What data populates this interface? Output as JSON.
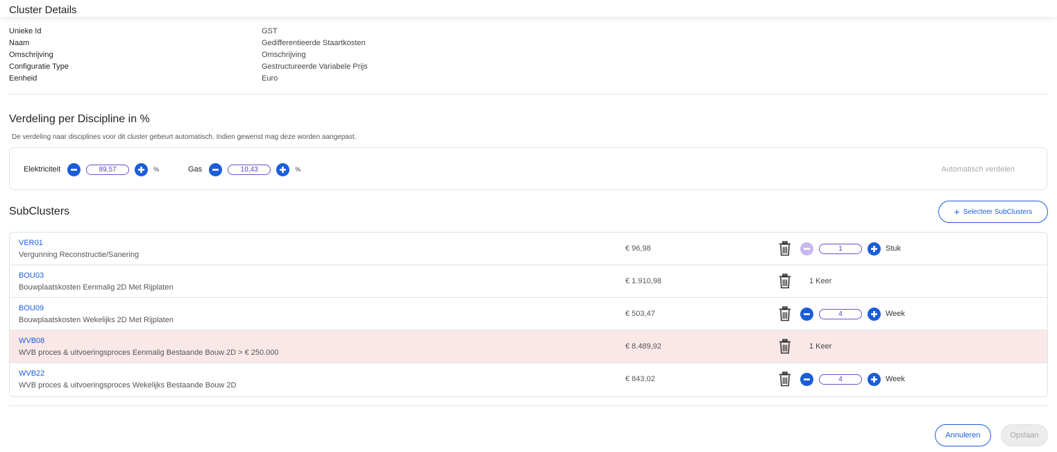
{
  "header": {
    "title": "Cluster Details"
  },
  "details": [
    {
      "label": "Unieke Id",
      "value": "GST"
    },
    {
      "label": "Naam",
      "value": "Gedifferentieerde Staartkosten"
    },
    {
      "label": "Omschrijving",
      "value": "Omschrijving"
    },
    {
      "label": "Configuratie Type",
      "value": "Gestructureerde Variabele Prijs"
    },
    {
      "label": "Eenheid",
      "value": "Euro"
    }
  ],
  "verdeling": {
    "title": "Verdeling per Discipline in %",
    "description": "De verdeling naar disciplines voor dit cluster gebeurt automatisch. Indien gewenst mag deze worden aangepast.",
    "disciplines": [
      {
        "label": "Elektriciteit",
        "value": "89,57",
        "unit": "%"
      },
      {
        "label": "Gas",
        "value": "10,43",
        "unit": "%"
      }
    ],
    "auto_label": "Automatisch verdelen"
  },
  "subclusters": {
    "title": "SubClusters",
    "select_button": "Selecteer SubClusters",
    "rows": [
      {
        "code": "VER01",
        "description": "Vergunning Reconstructie/Sanering",
        "price": "€ 96,98",
        "quantity": "1",
        "unit": "Stuk",
        "fixed": "",
        "highlight": false
      },
      {
        "code": "BOU03",
        "description": "Bouwplaatskosten Eenmalig 2D Met Rijplaten",
        "price": "€ 1.910,98",
        "quantity": "",
        "unit": "",
        "fixed": "1 Keer",
        "highlight": false
      },
      {
        "code": "BOU09",
        "description": "Bouwplaatskosten Wekelijks 2D Met Rijplaten",
        "price": "€ 503,47",
        "quantity": "4",
        "unit": "Week",
        "fixed": "",
        "highlight": false
      },
      {
        "code": "WVB08",
        "description": "WVB proces & uitvoeringsproces Eenmalig Bestaande Bouw 2D > € 250.000",
        "price": "€ 8.489,92",
        "quantity": "",
        "unit": "",
        "fixed": "1 Keer",
        "highlight": true
      },
      {
        "code": "WVB22",
        "description": "WVB proces & uitvoeringsproces Wekelijks Bestaande Bouw 2D",
        "price": "€ 843,02",
        "quantity": "4",
        "unit": "Week",
        "fixed": "",
        "highlight": false
      }
    ]
  },
  "footer": {
    "cancel_label": "Annuleren",
    "save_label": "Opslaan"
  },
  "colors": {
    "accent": "#1a5dd8",
    "highlight_row": "#fae8e8",
    "disabled_button": "#c9b8ee"
  },
  "icons": [
    "minus-circle-icon",
    "plus-circle-icon",
    "trash-icon",
    "plus-icon"
  ]
}
